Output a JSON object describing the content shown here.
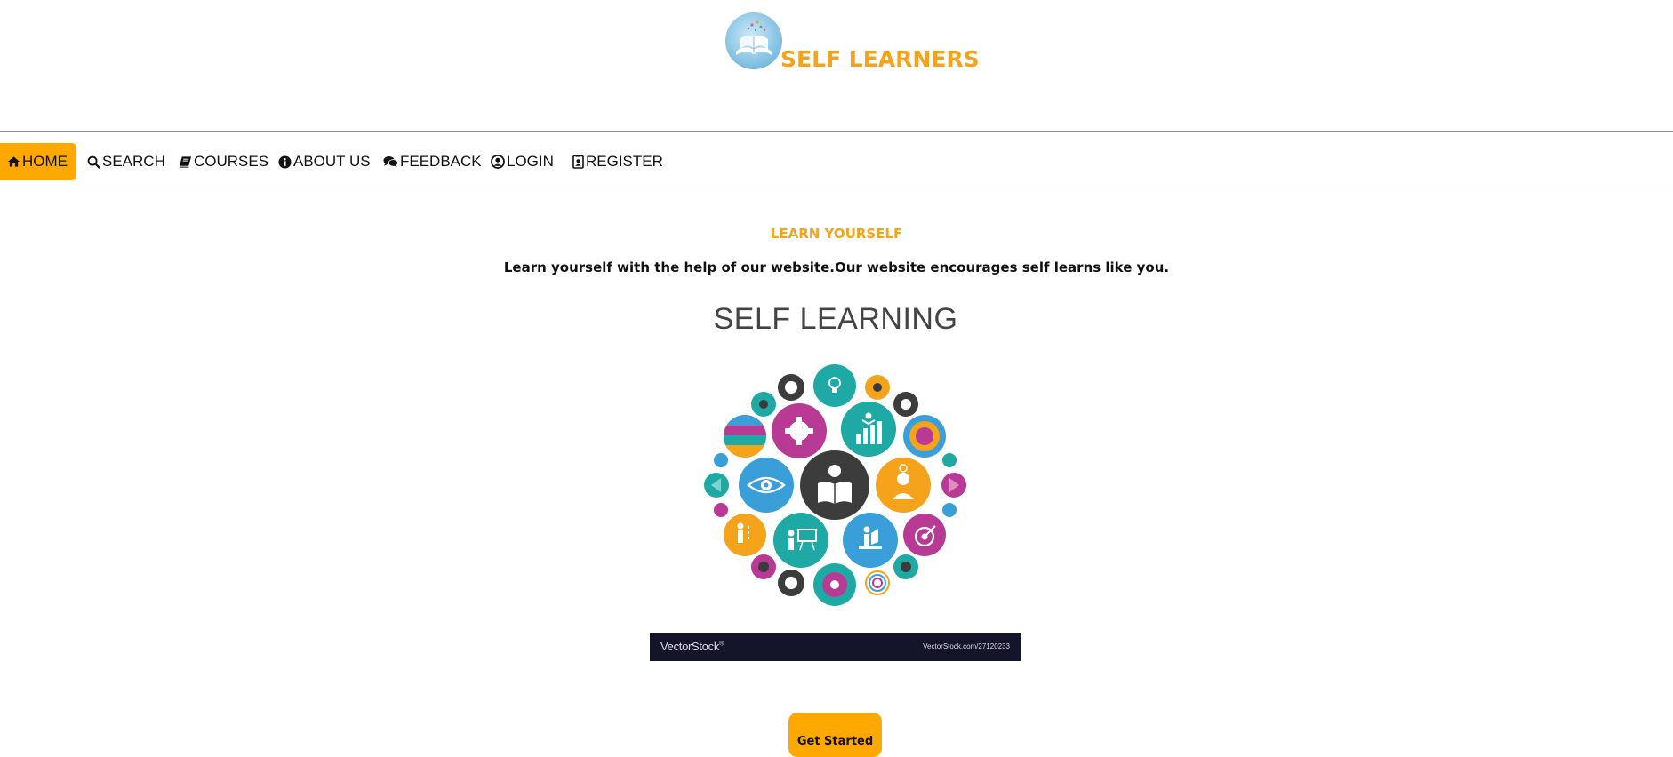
{
  "brand": {
    "name": "SELF LEARNERS",
    "logo_icon": "open-book-logo-icon",
    "color": "#f5a31a"
  },
  "nav": {
    "items": [
      {
        "label": "HOME",
        "icon": "home-icon",
        "active": true
      },
      {
        "label": "SEARCH",
        "icon": "search-icon",
        "active": false
      },
      {
        "label": "COURSES",
        "icon": "book-icon",
        "active": false
      },
      {
        "label": "ABOUT US",
        "icon": "info-icon",
        "active": false
      },
      {
        "label": "FEEDBACK",
        "icon": "comments-icon",
        "active": false
      },
      {
        "label": "LOGIN",
        "icon": "user-circle-icon",
        "active": false
      },
      {
        "label": "REGISTER",
        "icon": "id-badge-icon",
        "active": false
      }
    ],
    "active_color": "#ffa800"
  },
  "main": {
    "heading": "LEARN YOURSELF",
    "tagline": "Learn yourself with the help of our website.Our website encourages self learns like you.",
    "hero": {
      "title": "SELF LEARNING",
      "watermark_brand": "VectorStock",
      "watermark_mark": "®",
      "watermark_id": "VectorStock.com/27120233",
      "palette": [
        "#1fa9a4",
        "#b83a94",
        "#f5a31a",
        "#3a9fd8",
        "#3c3c3c"
      ]
    },
    "cta_label": "Get Started"
  }
}
